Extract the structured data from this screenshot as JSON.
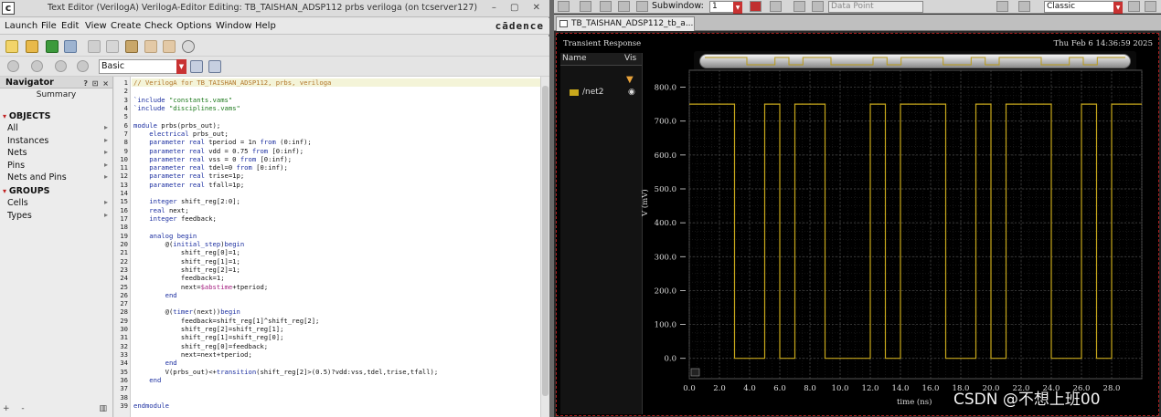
{
  "editor_window": {
    "title": "Text Editor (VerilogA) VerilogA-Editor Editing: TB_TAISHAN_ADSP112 prbs veriloga (on tcserver127)",
    "brand": "cādence",
    "menu": [
      "Launch",
      "File",
      "Edit",
      "View",
      "Create",
      "Check",
      "Options",
      "Window",
      "Help"
    ],
    "toolbar_combo": "Basic"
  },
  "navigator": {
    "title": "Navigator",
    "header_icons": "? ⊡ ×",
    "summary": "Summary",
    "sections": [
      {
        "name": "OBJECTS",
        "items": [
          "All",
          "Instances",
          "Nets",
          "Pins",
          "Nets and Pins"
        ]
      },
      {
        "name": "GROUPS",
        "items": [
          "Cells",
          "Types"
        ]
      }
    ]
  },
  "code_lines": [
    [
      {
        "t": "// VerilogA for TB_TAISHAN_ADSP112, prbs, veriloga",
        "c": "cm"
      }
    ],
    [],
    [
      {
        "t": "`include ",
        "c": "kw"
      },
      {
        "t": "\"constants.vams\"",
        "c": "str"
      }
    ],
    [
      {
        "t": "`include ",
        "c": "kw"
      },
      {
        "t": "\"disciplines.vams\"",
        "c": "str"
      }
    ],
    [],
    [
      {
        "t": "module ",
        "c": "kw"
      },
      {
        "t": "prbs(prbs_out);",
        "c": ""
      }
    ],
    [
      {
        "t": "    electrical ",
        "c": "kw"
      },
      {
        "t": "prbs_out;",
        "c": ""
      }
    ],
    [
      {
        "t": "    parameter real ",
        "c": "kw"
      },
      {
        "t": "tperiod = 1n ",
        "c": ""
      },
      {
        "t": "from ",
        "c": "kw"
      },
      {
        "t": "(0:inf);",
        "c": ""
      }
    ],
    [
      {
        "t": "    parameter real ",
        "c": "kw"
      },
      {
        "t": "vdd = 0.75 ",
        "c": ""
      },
      {
        "t": "from ",
        "c": "kw"
      },
      {
        "t": "[0:inf);",
        "c": ""
      }
    ],
    [
      {
        "t": "    parameter real ",
        "c": "kw"
      },
      {
        "t": "vss = 0 ",
        "c": ""
      },
      {
        "t": "from ",
        "c": "kw"
      },
      {
        "t": "[0:inf);",
        "c": ""
      }
    ],
    [
      {
        "t": "    parameter real ",
        "c": "kw"
      },
      {
        "t": "tdel=0 ",
        "c": ""
      },
      {
        "t": "from ",
        "c": "kw"
      },
      {
        "t": "[0:inf);",
        "c": ""
      }
    ],
    [
      {
        "t": "    parameter real ",
        "c": "kw"
      },
      {
        "t": "trise=1p;",
        "c": ""
      }
    ],
    [
      {
        "t": "    parameter real ",
        "c": "kw"
      },
      {
        "t": "tfall=1p;",
        "c": ""
      }
    ],
    [],
    [
      {
        "t": "    integer ",
        "c": "kw"
      },
      {
        "t": "shift_reg[2:0];",
        "c": ""
      }
    ],
    [
      {
        "t": "    real ",
        "c": "kw"
      },
      {
        "t": "next;",
        "c": ""
      }
    ],
    [
      {
        "t": "    integer ",
        "c": "kw"
      },
      {
        "t": "feedback;",
        "c": ""
      }
    ],
    [],
    [
      {
        "t": "    analog begin",
        "c": "kw"
      }
    ],
    [
      {
        "t": "        @(",
        "c": ""
      },
      {
        "t": "initial_step",
        "c": "kw"
      },
      {
        "t": ")",
        "c": ""
      },
      {
        "t": "begin",
        "c": "kw"
      }
    ],
    [
      {
        "t": "            shift_reg[0]=1;",
        "c": ""
      }
    ],
    [
      {
        "t": "            shift_reg[1]=1;",
        "c": ""
      }
    ],
    [
      {
        "t": "            shift_reg[2]=1;",
        "c": ""
      }
    ],
    [
      {
        "t": "            feedback=1;",
        "c": ""
      }
    ],
    [
      {
        "t": "            next=",
        "c": ""
      },
      {
        "t": "$abstime",
        "c": "vr"
      },
      {
        "t": "+tperiod;",
        "c": ""
      }
    ],
    [
      {
        "t": "        end",
        "c": "kw"
      }
    ],
    [],
    [
      {
        "t": "        @(",
        "c": ""
      },
      {
        "t": "timer",
        "c": "kw"
      },
      {
        "t": "(next))",
        "c": ""
      },
      {
        "t": "begin",
        "c": "kw"
      }
    ],
    [
      {
        "t": "            feedback=shift_reg[1]^shift_reg[2];",
        "c": ""
      }
    ],
    [
      {
        "t": "            shift_reg[2]=shift_reg[1];",
        "c": ""
      }
    ],
    [
      {
        "t": "            shift_reg[1]=shift_reg[0];",
        "c": ""
      }
    ],
    [
      {
        "t": "            shift_reg[0]=feedback;",
        "c": ""
      }
    ],
    [
      {
        "t": "            next=next+tperiod;",
        "c": ""
      }
    ],
    [
      {
        "t": "        end",
        "c": "kw"
      }
    ],
    [
      {
        "t": "        V(prbs_out)<+",
        "c": ""
      },
      {
        "t": "transition",
        "c": "kw"
      },
      {
        "t": "(shift_reg[2]>(0.5)?vdd:vss,tdel,trise,tfall);",
        "c": ""
      }
    ],
    [
      {
        "t": "    end",
        "c": "kw"
      }
    ],
    [],
    [],
    [
      {
        "t": "endmodule",
        "c": "kw"
      }
    ]
  ],
  "viewer": {
    "subwindow_label": "Subwindow:",
    "subwindow_value": "1",
    "marker_field": "Data Point",
    "style_field": "Classic",
    "tab_title": "TB_TAISHAN_ADSP112_tb_a...",
    "plot_title": "Transient Response",
    "datetime": "Thu Feb 6 14:36:59 2025",
    "legend_col_name": "Name",
    "legend_col_vis": "Vis",
    "signal_name": "/net2",
    "signal_color": "#c8a81c"
  },
  "chart_data": {
    "type": "line",
    "title": "Transient Response",
    "xlabel": "time (ns)",
    "ylabel": "V (mV)",
    "xlim": [
      0,
      30
    ],
    "ylim": [
      -60,
      850
    ],
    "x_ticks": [
      0.0,
      2.0,
      4.0,
      6.0,
      8.0,
      10.0,
      12.0,
      14.0,
      16.0,
      18.0,
      20.0,
      22.0,
      24.0,
      26.0,
      28.0
    ],
    "y_ticks": [
      0.0,
      100.0,
      200.0,
      300.0,
      400.0,
      500.0,
      600.0,
      700.0,
      800.0
    ],
    "grid": true,
    "series": [
      {
        "name": "/net2",
        "color": "#c8a81c",
        "x": [
          0,
          3,
          3,
          5,
          5,
          6,
          6,
          7,
          7,
          9,
          9,
          12,
          12,
          13,
          13,
          14,
          14,
          17,
          17,
          19,
          19,
          20,
          20,
          21,
          21,
          24,
          24,
          26,
          26,
          27,
          27,
          28,
          28,
          30
        ],
        "y": [
          750,
          750,
          0,
          0,
          750,
          750,
          0,
          0,
          750,
          750,
          0,
          0,
          750,
          750,
          0,
          0,
          750,
          750,
          0,
          0,
          750,
          750,
          0,
          0,
          750,
          750,
          0,
          0,
          750,
          750,
          0,
          0,
          750,
          750
        ]
      }
    ]
  },
  "watermark": "CSDN @不想上班00"
}
